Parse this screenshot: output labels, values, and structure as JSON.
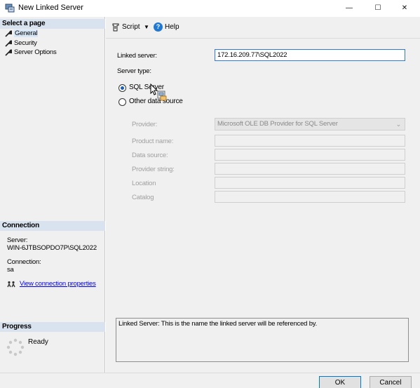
{
  "window": {
    "title": "New Linked Server",
    "controls": {
      "minimize": "—",
      "maximize": "☐",
      "close": "✕"
    }
  },
  "left_pane": {
    "select_page_header": "Select a page",
    "pages": [
      {
        "label": "General",
        "icon": "wrench-icon",
        "selected": true
      },
      {
        "label": "Security",
        "icon": "wrench-icon",
        "selected": false
      },
      {
        "label": "Server Options",
        "icon": "wrench-icon",
        "selected": false
      }
    ],
    "connection_header": "Connection",
    "connection": {
      "server_label": "Server:",
      "server_value": "WIN-6JTBSOPDO7P\\SQL2022",
      "connection_label": "Connection:",
      "connection_value": "sa",
      "view_properties_link": "View connection properties"
    },
    "progress_header": "Progress",
    "progress_status": "Ready"
  },
  "toolbar": {
    "script_label": "Script",
    "script_caret": "▼",
    "help_icon": "?",
    "help_label": "Help"
  },
  "general": {
    "linked_server_label": "Linked server:",
    "linked_server_value": "172.16.209.77\\SQL2022",
    "server_type_label": "Server type:",
    "server_type_options": [
      {
        "label": "SQL Server",
        "checked": true
      },
      {
        "label": "Other data source",
        "checked": false
      }
    ],
    "provider_label": "Provider:",
    "provider_value": "Microsoft OLE DB Provider for SQL Server",
    "product_name_label": "Product name:",
    "product_name_value": "",
    "data_source_label": "Data source:",
    "data_source_value": "",
    "provider_string_label": "Provider string:",
    "provider_string_value": "",
    "location_label": "Location",
    "location_value": "",
    "catalog_label": "Catalog",
    "catalog_value": ""
  },
  "description": "Linked Server: This is the name the linked server will be referenced by.",
  "buttons": {
    "ok": "OK",
    "cancel": "Cancel"
  },
  "colors": {
    "accent": "#0078d7",
    "section_header_bg": "#d9e3f0",
    "pane_bg": "#f0f0f0",
    "link": "#0000ee"
  }
}
